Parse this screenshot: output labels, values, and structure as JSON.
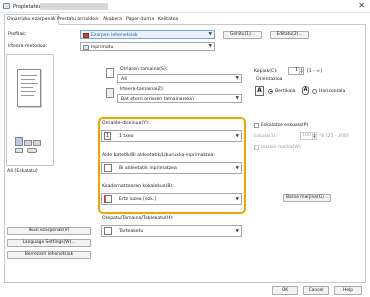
{
  "window": {
    "title": "Propietateak:",
    "close_glyph": "✕"
  },
  "tabs": [
    {
      "label": "Oinarrizko ezarpenak",
      "active": true
    },
    {
      "label": "Prestatu orrialdea",
      "active": false
    },
    {
      "label": "Akabera",
      "active": false
    },
    {
      "label": "Paper-iturria",
      "active": false
    },
    {
      "label": "Kalitatea",
      "active": false
    }
  ],
  "profile": {
    "label": "Profilak:",
    "value": "Ezarpen lehenetsiak",
    "add_label": "Gehitu(1)...",
    "edit_label": "Editatu(2)..."
  },
  "output_method": {
    "label": "Irteera-metodoa:",
    "value": "Inprimatu"
  },
  "page_size": {
    "label": "Orriaren tamaina(S):",
    "value": "A4"
  },
  "output_size": {
    "label": "Irteera-tamaina(Z):",
    "value": "Bat etorri orriaren tamainarekin"
  },
  "copies": {
    "label": "Kopiak(C):",
    "value": "1",
    "range": "[1 - ∞]"
  },
  "orientation": {
    "label": "Orientazioa",
    "portrait_label": "Bertikala",
    "landscape_label": "Horizontala",
    "selected": "portrait"
  },
  "preview": {
    "caption": "A4 [Eskalatu]"
  },
  "page_layout": {
    "label": "Orrialde-diseinua(Y):",
    "value": "1 txeo"
  },
  "manual_scaling": {
    "label": "Eskalatze eskuala(P)",
    "checked": false,
    "scale_label": "Eskala(1):",
    "scale_value": "100",
    "scale_range": "% [25 - 200]"
  },
  "duplex": {
    "label": "Alde batetik/Bi aldeetatik/Liburuxka-inprimatzea:",
    "value": "Bi aldeetatik inprimatzea"
  },
  "watermark": {
    "label": "Iruzkin-marka(W)",
    "checked": false
  },
  "collate": {
    "label": "Koadernatzearen kokalekua(B):",
    "value": "Ertz luzea [ezk.]"
  },
  "binding_button": {
    "label": "Barne marjina(G)..."
  },
  "paper_source": {
    "label": "Orepatu/Tamaina/Tablekatu(H):",
    "value": "Tarteaketu"
  },
  "left_buttons": [
    {
      "label": "Ikusi ezarpenak(V)"
    },
    {
      "label": "Language Settings(W)..."
    },
    {
      "label": "Berrezarri lehenetsiak"
    }
  ],
  "footer": {
    "ok_label": "OK",
    "cancel_label": "Cancel",
    "help_label": "Help"
  },
  "colors": {
    "highlight": "#f0a800",
    "accent": "#1b5fa8"
  }
}
